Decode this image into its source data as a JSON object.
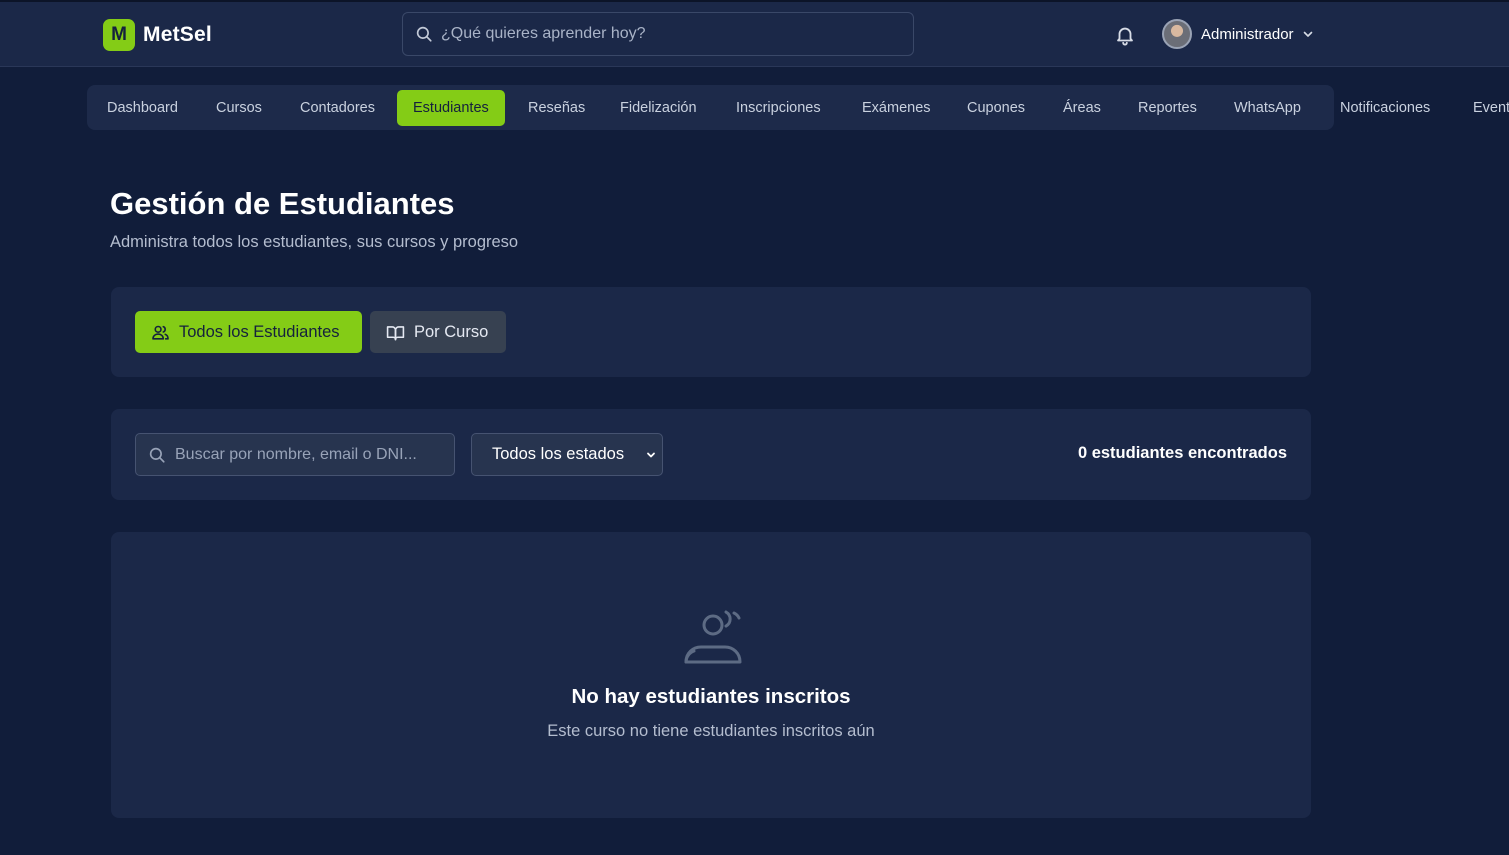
{
  "header": {
    "logo_letter": "M",
    "logo_text": "MetSel",
    "search_placeholder": "¿Qué quieres aprender hoy?",
    "user_name": "Administrador"
  },
  "nav": {
    "items": [
      {
        "label": "Dashboard"
      },
      {
        "label": "Cursos"
      },
      {
        "label": "Contadores"
      },
      {
        "label": "Estudiantes",
        "active": true
      },
      {
        "label": "Reseñas"
      },
      {
        "label": "Fidelización"
      },
      {
        "label": "Inscripciones"
      },
      {
        "label": "Exámenes"
      },
      {
        "label": "Cupones"
      },
      {
        "label": "Áreas"
      },
      {
        "label": "Reportes"
      },
      {
        "label": "WhatsApp"
      },
      {
        "label": "Notificaciones"
      },
      {
        "label": "Event"
      }
    ]
  },
  "page": {
    "title": "Gestión de Estudiantes",
    "subtitle": "Administra todos los estudiantes, sus cursos y progreso"
  },
  "view_toggle": {
    "all_label": "Todos los Estudiantes",
    "by_course_label": "Por Curso"
  },
  "filters": {
    "search_placeholder": "Buscar por nombre, email o DNI...",
    "status_selected": "Todos los estados",
    "results_count": "0 estudiantes encontrados"
  },
  "empty_state": {
    "title": "No hay estudiantes inscritos",
    "message": "Este curso no tiene estudiantes inscritos aún"
  },
  "colors": {
    "background": "#111d3a",
    "card": "#1b2848",
    "accent": "#84cc16",
    "secondary_button": "#374151"
  },
  "icons": {
    "search": "search-icon",
    "bell": "bell-icon",
    "chevron": "chevron-down-icon",
    "users": "users-icon",
    "book": "book-open-icon",
    "empty": "users-empty-icon"
  }
}
